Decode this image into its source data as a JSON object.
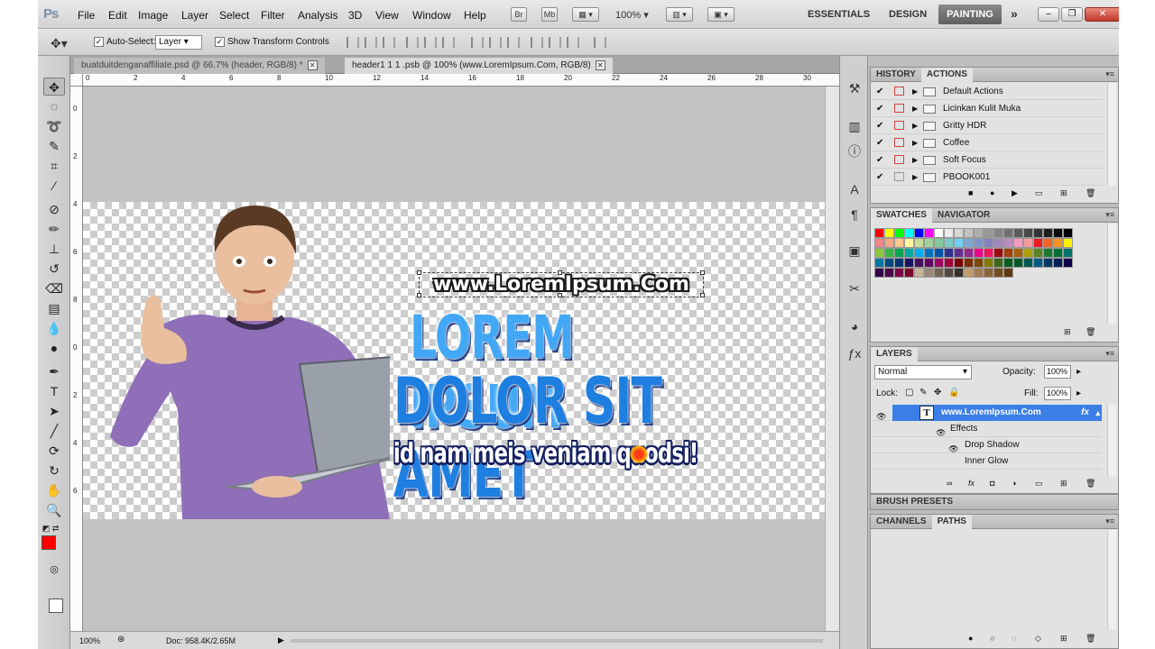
{
  "app": {
    "logo": "Ps",
    "menu": [
      "File",
      "Edit",
      "Image",
      "Layer",
      "Select",
      "Filter",
      "Analysis",
      "3D",
      "View",
      "Window",
      "Help"
    ],
    "bridge_btn": "Br",
    "minibridge_btn": "Mb",
    "zoom_level": "100%",
    "workspaces": [
      "ESSENTIALS",
      "DESIGN"
    ],
    "active_workspace": "PAINTING",
    "more_workspaces": "»"
  },
  "options": {
    "auto_select_label": "Auto-Select:",
    "auto_select_value": "Layer",
    "show_transform_label": "Show Transform Controls"
  },
  "tabs": [
    {
      "title": "buatduitdenganaffiliate.psd @ 66.7% (header, RGB/8) *"
    },
    {
      "title": "header1 1 1 .psb @ 100% (www.LoremIpsum.Com, RGB/8)"
    }
  ],
  "ruler": {
    "top": [
      "0",
      "2",
      "4",
      "6",
      "8",
      "10",
      "12",
      "14",
      "16",
      "18",
      "20",
      "22",
      "24",
      "26",
      "28",
      "30"
    ],
    "left": [
      "0",
      "2",
      "4",
      "6",
      "8",
      "0",
      "2",
      "4",
      "6"
    ]
  },
  "canvas": {
    "url_text": "www.LoremIpsum.Com",
    "headline_1": "LOREM IPSUM",
    "headline_2": "DOLOR SIT AMET",
    "tagline": "id nam meis veniam quodsi!"
  },
  "status": {
    "zoom": "100%",
    "doc_size": "Doc: 958.4K/2.65M"
  },
  "panels": {
    "history_tab": "HISTORY",
    "actions_tab": "ACTIONS",
    "actions": [
      {
        "label": "Default Actions"
      },
      {
        "label": "Licinkan Kulit Muka"
      },
      {
        "label": "Gritty HDR"
      },
      {
        "label": "Coffee"
      },
      {
        "label": "Soft Focus"
      },
      {
        "label": "PBOOK001"
      }
    ],
    "swatches_tab": "SWATCHES",
    "navigator_tab": "NAVIGATOR",
    "layers_tab": "LAYERS",
    "blend_mode": "Normal",
    "opacity_label": "Opacity:",
    "opacity_value": "100%",
    "lock_label": "Lock:",
    "fill_label": "Fill:",
    "fill_value": "100%",
    "layers": [
      {
        "name": "www.LoremIpsum.Com",
        "fx": "fx"
      },
      {
        "name": "Effects"
      },
      {
        "name": "Drop Shadow"
      },
      {
        "name": "Inner Glow"
      }
    ],
    "brush_presets_tab": "BRUSH PRESETS",
    "channels_tab": "CHANNELS",
    "paths_tab": "PATHS"
  },
  "colors": {
    "foreground": "#ff0000",
    "background": "#ffffff",
    "accent": "#3b7ee6"
  }
}
